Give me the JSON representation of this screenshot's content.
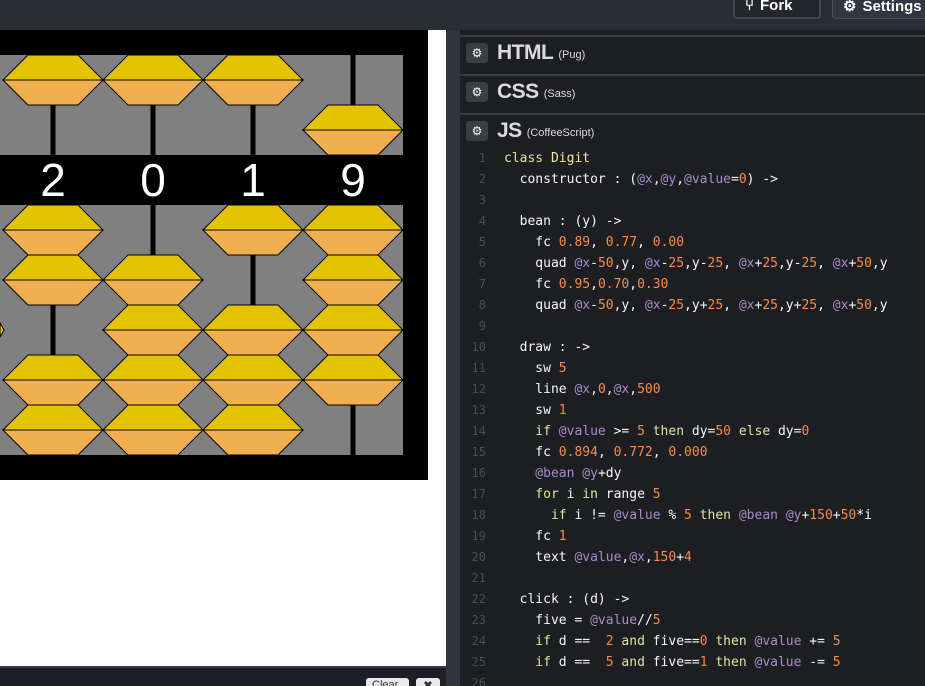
{
  "toolbar": {
    "fork_label": "Fork",
    "settings_label": "Settings"
  },
  "preview": {
    "digits": [
      "2",
      "0",
      "1",
      "9"
    ],
    "colors": {
      "bead_top": "#e3c300",
      "bead_bottom": "#f2af50",
      "rod": "#000000",
      "bg": "#808080"
    }
  },
  "console": {
    "clear_label": "Clear",
    "close_label": "✖"
  },
  "editors": [
    {
      "lang": "HTML",
      "preprocessor": "(Pug)"
    },
    {
      "lang": "CSS",
      "preprocessor": "(Sass)"
    },
    {
      "lang": "JS",
      "preprocessor": "(CoffeeScript)"
    }
  ],
  "code_lines": [
    {
      "n": "1",
      "tokens": [
        [
          "kw",
          "class "
        ],
        [
          "cls",
          "Digit"
        ]
      ]
    },
    {
      "n": "2",
      "tokens": [
        [
          "pl",
          "  constructor : ("
        ],
        [
          "at",
          "@x"
        ],
        [
          "pl",
          ","
        ],
        [
          "at",
          "@y"
        ],
        [
          "pl",
          ","
        ],
        [
          "at",
          "@value"
        ],
        [
          "pl",
          "="
        ],
        [
          "num",
          "0"
        ],
        [
          "pl",
          ") ->"
        ]
      ]
    },
    {
      "n": "3",
      "tokens": []
    },
    {
      "n": "4",
      "tokens": [
        [
          "pl",
          "  bean : (y) ->"
        ]
      ]
    },
    {
      "n": "5",
      "tokens": [
        [
          "pl",
          "    fc "
        ],
        [
          "num",
          "0.89"
        ],
        [
          "pl",
          ", "
        ],
        [
          "num",
          "0.77"
        ],
        [
          "pl",
          ", "
        ],
        [
          "num",
          "0.00"
        ]
      ]
    },
    {
      "n": "6",
      "tokens": [
        [
          "pl",
          "    quad "
        ],
        [
          "at",
          "@x"
        ],
        [
          "pl",
          "-"
        ],
        [
          "num",
          "50"
        ],
        [
          "pl",
          ",y, "
        ],
        [
          "at",
          "@x"
        ],
        [
          "pl",
          "-"
        ],
        [
          "num",
          "25"
        ],
        [
          "pl",
          ",y-"
        ],
        [
          "num",
          "25"
        ],
        [
          "pl",
          ", "
        ],
        [
          "at",
          "@x"
        ],
        [
          "pl",
          "+"
        ],
        [
          "num",
          "25"
        ],
        [
          "pl",
          ",y-"
        ],
        [
          "num",
          "25"
        ],
        [
          "pl",
          ", "
        ],
        [
          "at",
          "@x"
        ],
        [
          "pl",
          "+"
        ],
        [
          "num",
          "50"
        ],
        [
          "pl",
          ",y"
        ]
      ]
    },
    {
      "n": "7",
      "tokens": [
        [
          "pl",
          "    fc "
        ],
        [
          "num",
          "0.95"
        ],
        [
          "pl",
          ","
        ],
        [
          "num",
          "0.70"
        ],
        [
          "pl",
          ","
        ],
        [
          "num",
          "0.30"
        ]
      ]
    },
    {
      "n": "8",
      "tokens": [
        [
          "pl",
          "    quad "
        ],
        [
          "at",
          "@x"
        ],
        [
          "pl",
          "-"
        ],
        [
          "num",
          "50"
        ],
        [
          "pl",
          ",y, "
        ],
        [
          "at",
          "@x"
        ],
        [
          "pl",
          "-"
        ],
        [
          "num",
          "25"
        ],
        [
          "pl",
          ",y+"
        ],
        [
          "num",
          "25"
        ],
        [
          "pl",
          ", "
        ],
        [
          "at",
          "@x"
        ],
        [
          "pl",
          "+"
        ],
        [
          "num",
          "25"
        ],
        [
          "pl",
          ",y+"
        ],
        [
          "num",
          "25"
        ],
        [
          "pl",
          ", "
        ],
        [
          "at",
          "@x"
        ],
        [
          "pl",
          "+"
        ],
        [
          "num",
          "50"
        ],
        [
          "pl",
          ",y"
        ]
      ]
    },
    {
      "n": "9",
      "tokens": []
    },
    {
      "n": "10",
      "tokens": [
        [
          "pl",
          "  draw : ->"
        ]
      ]
    },
    {
      "n": "11",
      "tokens": [
        [
          "pl",
          "    sw "
        ],
        [
          "num",
          "5"
        ]
      ]
    },
    {
      "n": "12",
      "tokens": [
        [
          "pl",
          "    line "
        ],
        [
          "at",
          "@x"
        ],
        [
          "pl",
          ","
        ],
        [
          "num",
          "0"
        ],
        [
          "pl",
          ","
        ],
        [
          "at",
          "@x"
        ],
        [
          "pl",
          ","
        ],
        [
          "num",
          "500"
        ]
      ]
    },
    {
      "n": "13",
      "tokens": [
        [
          "pl",
          "    sw "
        ],
        [
          "num",
          "1"
        ]
      ]
    },
    {
      "n": "14",
      "tokens": [
        [
          "kw",
          "    if "
        ],
        [
          "at",
          "@value"
        ],
        [
          "pl",
          " >= "
        ],
        [
          "num",
          "5"
        ],
        [
          "kw",
          " then "
        ],
        [
          "pl",
          "dy="
        ],
        [
          "num",
          "50"
        ],
        [
          "kw",
          " else "
        ],
        [
          "pl",
          "dy="
        ],
        [
          "num",
          "0"
        ]
      ]
    },
    {
      "n": "15",
      "tokens": [
        [
          "pl",
          "    fc "
        ],
        [
          "num",
          "0.894"
        ],
        [
          "pl",
          ", "
        ],
        [
          "num",
          "0.772"
        ],
        [
          "pl",
          ", "
        ],
        [
          "num",
          "0.000"
        ]
      ]
    },
    {
      "n": "16",
      "tokens": [
        [
          "at",
          "    @bean "
        ],
        [
          "at",
          "@y"
        ],
        [
          "pl",
          "+dy"
        ]
      ]
    },
    {
      "n": "17",
      "tokens": [
        [
          "kw",
          "    for "
        ],
        [
          "pl",
          "i "
        ],
        [
          "kw",
          "in "
        ],
        [
          "pl",
          "range "
        ],
        [
          "num",
          "5"
        ]
      ]
    },
    {
      "n": "18",
      "tokens": [
        [
          "kw",
          "      if "
        ],
        [
          "pl",
          "i != "
        ],
        [
          "at",
          "@value"
        ],
        [
          "pl",
          " % "
        ],
        [
          "num",
          "5"
        ],
        [
          "kw",
          " then "
        ],
        [
          "at",
          "@bean "
        ],
        [
          "at",
          "@y"
        ],
        [
          "pl",
          "+"
        ],
        [
          "num",
          "150"
        ],
        [
          "pl",
          "+"
        ],
        [
          "num",
          "50"
        ],
        [
          "pl",
          "*i"
        ]
      ]
    },
    {
      "n": "19",
      "tokens": [
        [
          "pl",
          "    fc "
        ],
        [
          "num",
          "1"
        ]
      ]
    },
    {
      "n": "20",
      "tokens": [
        [
          "pl",
          "    text "
        ],
        [
          "at",
          "@value"
        ],
        [
          "pl",
          ","
        ],
        [
          "at",
          "@x"
        ],
        [
          "pl",
          ","
        ],
        [
          "num",
          "150"
        ],
        [
          "pl",
          "+"
        ],
        [
          "num",
          "4"
        ]
      ]
    },
    {
      "n": "21",
      "tokens": []
    },
    {
      "n": "22",
      "tokens": [
        [
          "pl",
          "  click : (d) ->"
        ]
      ]
    },
    {
      "n": "23",
      "tokens": [
        [
          "pl",
          "    five = "
        ],
        [
          "at",
          "@value"
        ],
        [
          "pl",
          "//"
        ],
        [
          "num",
          "5"
        ]
      ]
    },
    {
      "n": "24",
      "tokens": [
        [
          "kw",
          "    if "
        ],
        [
          "pl",
          "d ==  "
        ],
        [
          "num",
          "2"
        ],
        [
          "kw",
          " and "
        ],
        [
          "pl",
          "five=="
        ],
        [
          "num",
          "0"
        ],
        [
          "kw",
          " then "
        ],
        [
          "at",
          "@value"
        ],
        [
          "pl",
          " += "
        ],
        [
          "num",
          "5"
        ]
      ]
    },
    {
      "n": "25",
      "tokens": [
        [
          "kw",
          "    if "
        ],
        [
          "pl",
          "d ==  "
        ],
        [
          "num",
          "5"
        ],
        [
          "kw",
          " and "
        ],
        [
          "pl",
          "five=="
        ],
        [
          "num",
          "1"
        ],
        [
          "kw",
          " then "
        ],
        [
          "at",
          "@value"
        ],
        [
          "pl",
          " -= "
        ],
        [
          "num",
          "5"
        ]
      ]
    },
    {
      "n": "26",
      "tokens": []
    }
  ]
}
